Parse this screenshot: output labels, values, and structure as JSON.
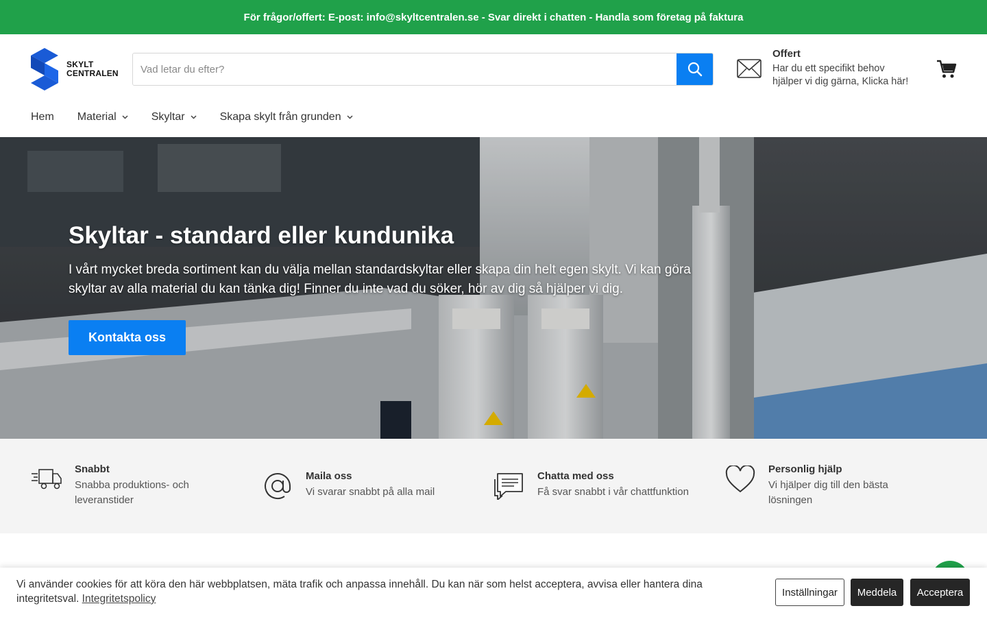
{
  "topbar": {
    "text": "För frågor/offert: E-post: info@skyltcentralen.se - Svar direkt i chatten - Handla som företag på faktura"
  },
  "logo": {
    "line1": "SKYLT",
    "line2": "CENTRALEN"
  },
  "search": {
    "placeholder": "Vad letar du efter?"
  },
  "offert": {
    "title": "Offert",
    "description": "Har du ett specifikt behov hjälper vi dig gärna, Klicka här!"
  },
  "nav": {
    "items": [
      {
        "label": "Hem"
      },
      {
        "label": "Material"
      },
      {
        "label": "Skyltar"
      },
      {
        "label": "Skapa skylt från grunden"
      }
    ]
  },
  "hero": {
    "title": "Skyltar - standard eller kundunika",
    "text": "I vårt mycket breda sortiment kan du välja mellan standardskyltar eller skapa din helt egen skylt. Vi kan göra skyltar av alla material du kan tänka dig! Finner du inte vad du söker, hör av dig så hjälper vi dig.",
    "button": "Kontakta oss"
  },
  "features": [
    {
      "title": "Snabbt",
      "desc": "Snabba produktions- och leveranstider",
      "icon": "truck-icon"
    },
    {
      "title": "Maila oss",
      "desc": "Vi svarar snabbt på alla mail",
      "icon": "at-icon"
    },
    {
      "title": "Chatta med oss",
      "desc": "Få svar snabbt i vår chattfunktion",
      "icon": "chat-icon"
    },
    {
      "title": "Personlig hjälp",
      "desc": "Vi hjälper dig till den bästa lösningen",
      "icon": "heart-icon"
    }
  ],
  "cookie": {
    "text": "Vi använder cookies för att köra den här webbplatsen, mäta trafik och anpassa innehåll. Du kan när som helst acceptera, avvisa eller hantera dina integritetsval.",
    "link": "Integritetspolicy",
    "settings": "Inställningar",
    "deny": "Meddela",
    "accept": "Acceptera"
  },
  "colors": {
    "topbar": "#20a14a",
    "accent": "#0a7ff2",
    "logo": "#1a5bd6",
    "dark_button": "#262626"
  }
}
